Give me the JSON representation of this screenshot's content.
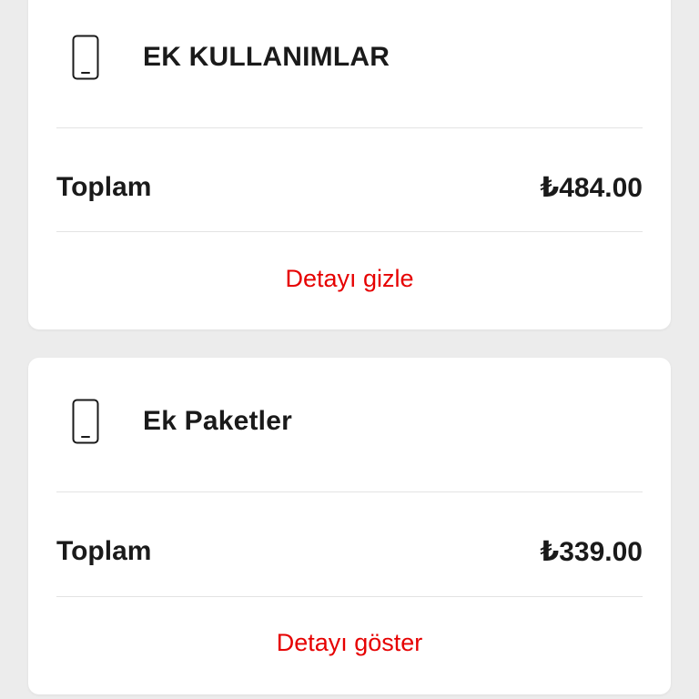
{
  "colors": {
    "background": "#ececec",
    "card": "#ffffff",
    "text": "#1a1a1a",
    "accent": "#e60000",
    "divider": "#e3e3e3"
  },
  "cards": [
    {
      "icon": "mobile-phone-icon",
      "title": "EK KULLANIMLAR",
      "total_label": "Toplam",
      "total_value": "₺484.00",
      "link_label": "Detayı gizle"
    },
    {
      "icon": "mobile-phone-icon",
      "title": "Ek Paketler",
      "total_label": "Toplam",
      "total_value": "₺339.00",
      "link_label": "Detayı göster"
    }
  ]
}
